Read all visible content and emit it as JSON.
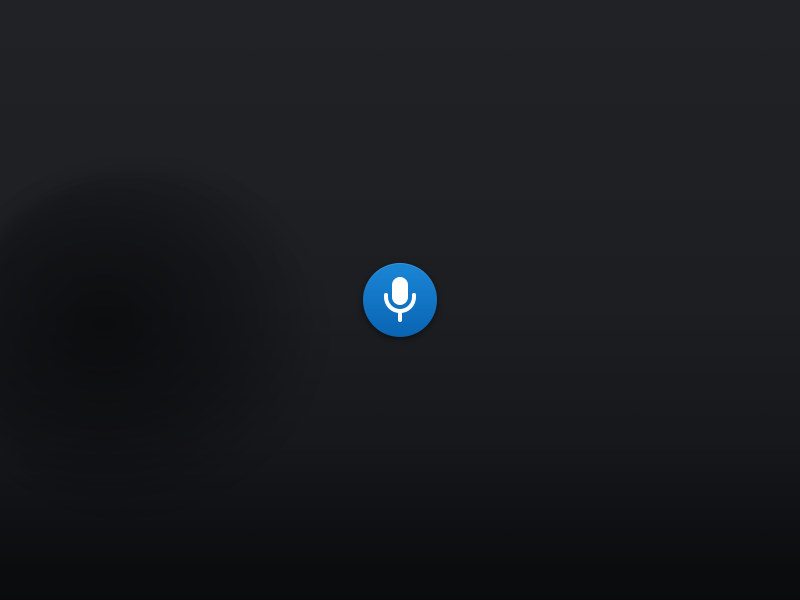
{
  "screen": {
    "background_color": "#1e2024"
  },
  "mic_button": {
    "icon": "microphone-icon",
    "accent_color": "#0f74c6",
    "icon_color": "#ffffff"
  }
}
